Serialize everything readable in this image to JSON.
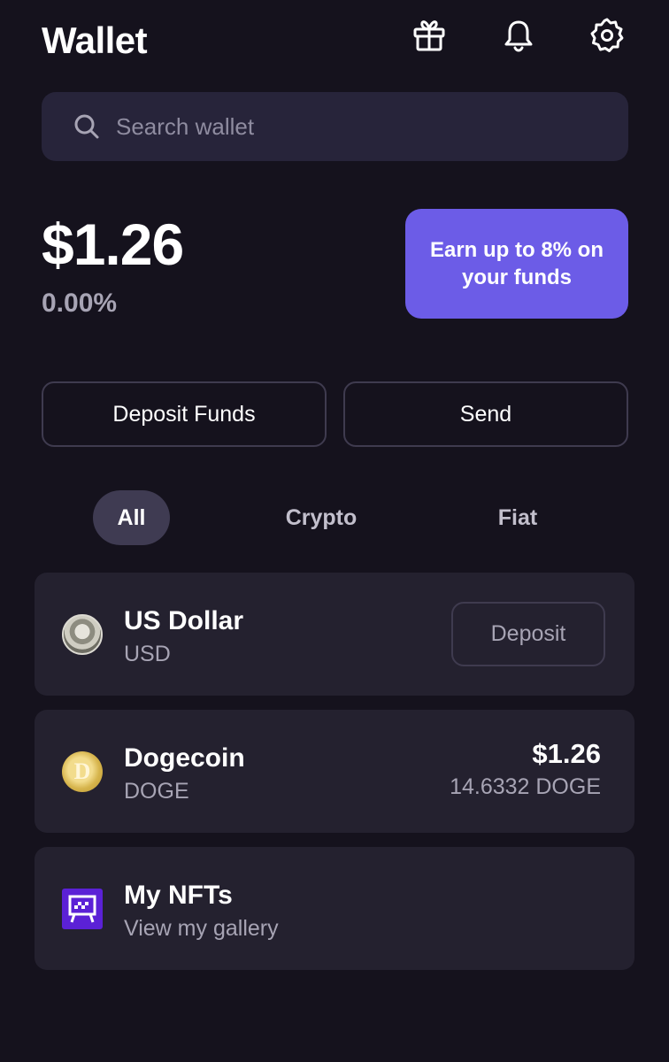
{
  "header": {
    "title": "Wallet",
    "icons": [
      "gift-icon",
      "bell-icon",
      "settings-icon"
    ]
  },
  "search": {
    "placeholder": "Search wallet",
    "value": ""
  },
  "balance": {
    "total": "$1.26",
    "change": "0.00%"
  },
  "promo": {
    "label": "Earn up to 8% on your funds"
  },
  "actions": {
    "deposit_label": "Deposit Funds",
    "send_label": "Send"
  },
  "tabs": [
    {
      "label": "All",
      "active": true
    },
    {
      "label": "Crypto",
      "active": false
    },
    {
      "label": "Fiat",
      "active": false
    }
  ],
  "assets": {
    "usd": {
      "name": "US Dollar",
      "ticker": "USD",
      "button_label": "Deposit"
    },
    "doge": {
      "name": "Dogecoin",
      "ticker": "DOGE",
      "value": "$1.26",
      "amount": "14.6332 DOGE"
    },
    "nfts": {
      "name": "My NFTs",
      "subtitle": "View my gallery"
    }
  },
  "colors": {
    "background": "#15121d",
    "card": "#24212f",
    "accent": "#6c5ce7",
    "muted_text": "#a7a4b4"
  }
}
